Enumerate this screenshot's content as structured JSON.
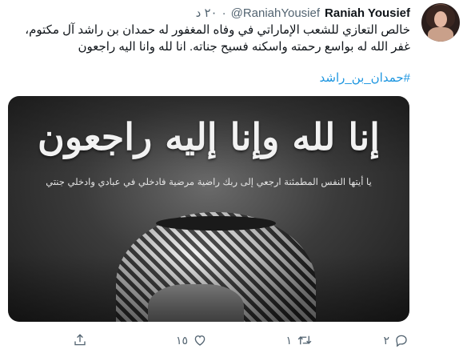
{
  "user": {
    "name": "Raniah Yousief",
    "handle": "@RaniahYousief",
    "separator": "·",
    "time": "٢٠ د"
  },
  "tweet": {
    "lines": [
      "خالص التعازي للشعب الإماراتي في وفاه المغفور له حمدان بن راشد آل مكتوم،",
      "غفر الله له  بواسع رحمته واسكنه فسيح جناته. انا لله وانا اليه راجعون"
    ],
    "hashtag": "#حمدان_بن_راشد"
  },
  "media": {
    "calligraphy_main": "إنا لله وإنا إليه راجعون",
    "calligraphy_sub": "يا أيتها النفس المطمئنة ارجعي إلى ربك راضية مرضية فادخلي في عبادي وادخلي جنتي"
  },
  "actions": {
    "reply_count": "٢",
    "retweet_count": "١",
    "like_count": "١٥",
    "share_count": ""
  },
  "icons": {
    "reply": "reply-icon",
    "retweet": "retweet-icon",
    "like": "heart-icon",
    "share": "share-icon"
  }
}
